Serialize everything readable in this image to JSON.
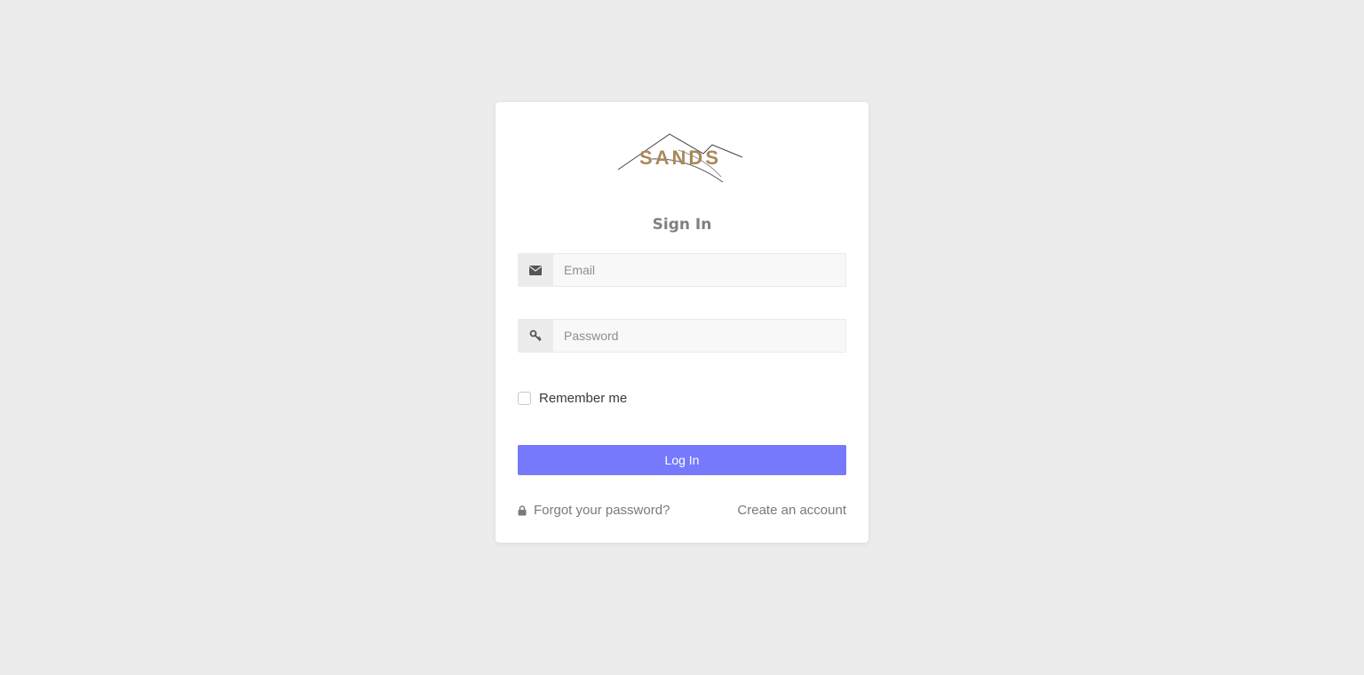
{
  "login": {
    "title": "Sign In",
    "email": {
      "placeholder": "Email",
      "icon": "envelope-icon"
    },
    "password": {
      "placeholder": "Password",
      "icon": "key-icon"
    },
    "remember_label": "Remember me",
    "remember_checked": false,
    "submit_label": "Log In",
    "forgot_label": "Forgot your password?",
    "forgot_icon": "lock-icon",
    "create_label": "Create an account"
  },
  "brand": {
    "logo_text": "SANDS",
    "logo_color": "#a8895a"
  },
  "colors": {
    "background": "#ececec",
    "accent": "#7679fb"
  }
}
